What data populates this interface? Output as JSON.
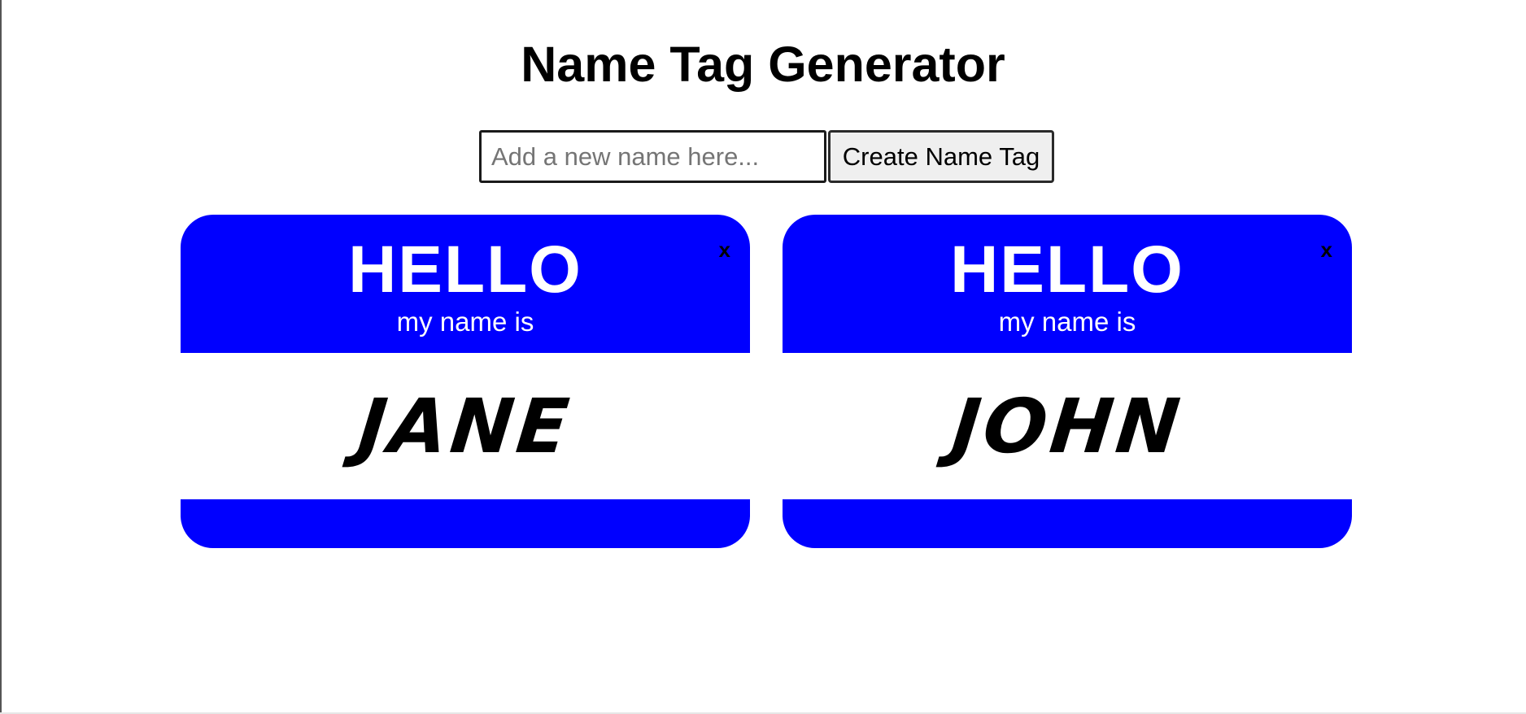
{
  "page": {
    "title": "Name Tag Generator"
  },
  "form": {
    "input_placeholder": "Add a new name here...",
    "input_value": "",
    "button_label": "Create Name Tag"
  },
  "colors": {
    "tag_accent": "#0000ff",
    "tag_text": "#ffffff",
    "name_text": "#000000"
  },
  "tags": [
    {
      "greeting": "HELLO",
      "subtitle": "my name is",
      "name": "JANE",
      "close_label": "x",
      "close_icon": "close-icon"
    },
    {
      "greeting": "HELLO",
      "subtitle": "my name is",
      "name": "JOHN",
      "close_label": "x",
      "close_icon": "close-icon"
    }
  ]
}
